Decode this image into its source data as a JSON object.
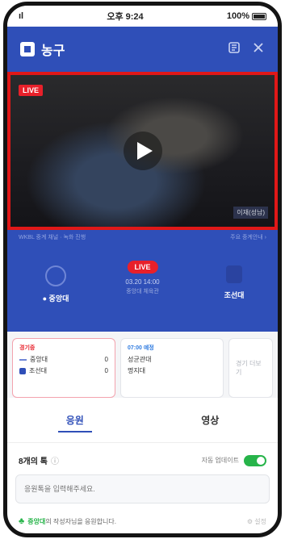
{
  "statusbar": {
    "signal": "ıl",
    "time": "오후 9:24",
    "battery": "100%"
  },
  "appbar": {
    "title": "농구",
    "icons": [
      "square-logo-icon",
      "share-icon",
      "close-icon"
    ]
  },
  "video": {
    "live_label": "LIVE",
    "caption": "이재(성남)",
    "play_icon": "play-icon"
  },
  "scoreboard": {
    "meta_left": "WKBL  중계 채널 · 녹화 진행",
    "meta_right": "주요 중계안내 ›",
    "home_team": {
      "name": "● 중앙대"
    },
    "away_team": {
      "name": "조선대"
    },
    "status": "LIVE",
    "time": "03.20 14:00",
    "sub": "중앙대 체육관"
  },
  "cards": [
    {
      "tag": "경기중",
      "rows": [
        {
          "label": "중앙대",
          "score": "0"
        },
        {
          "label": "조선대",
          "score": "0"
        }
      ]
    },
    {
      "tag": "07:00 예정",
      "rows": [
        {
          "label": "성균관대",
          "score": ""
        },
        {
          "label": "명지대",
          "score": ""
        }
      ]
    },
    {
      "tag": "",
      "placeholder": "경기 더보기"
    }
  ],
  "tabs": [
    {
      "label": "응원"
    },
    {
      "label": "영상"
    }
  ],
  "chat": {
    "title": "8개의 톡",
    "info_icon": "ⓘ",
    "toggle_label": "자동 업데이트",
    "input_placeholder": "응원톡을 입력해주세요.",
    "notice_team": "중앙대",
    "notice_text": "의 작성자님을 응원합니다.",
    "notice_settings": "⚙ 설정"
  }
}
